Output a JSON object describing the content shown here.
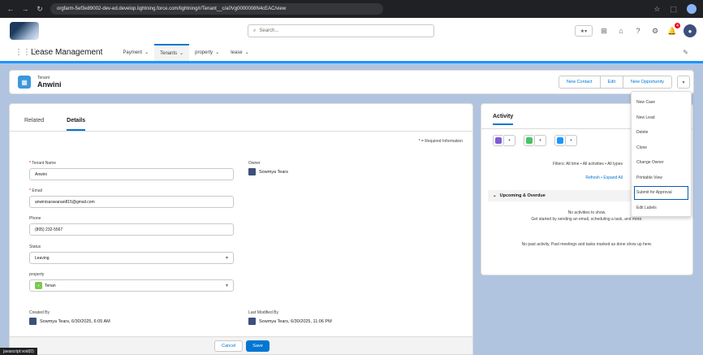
{
  "browser": {
    "url": "orgfarm-5ef3e89002-dev-ed.develop.lightning.force.com/lightning/r/Tenant__c/a0Vg0000008N4cEAC/view"
  },
  "search": {
    "placeholder": "Search..."
  },
  "nav": {
    "app_name": "Lease Management",
    "tabs": [
      {
        "label": "Payment"
      },
      {
        "label": "Tenants"
      },
      {
        "label": "property"
      },
      {
        "label": "lease"
      }
    ]
  },
  "record": {
    "type_label": "Tenant",
    "name": "Anwini",
    "actions": [
      "New Contact",
      "Edit",
      "New Opportunity"
    ]
  },
  "dropdown": {
    "items": [
      "New Case",
      "New Lead",
      "Delete",
      "Clone",
      "Change Owner",
      "Printable View",
      "Submit for Approval",
      "Edit Labels"
    ],
    "focused_index": 6
  },
  "tabs": {
    "related": "Related",
    "details": "Details"
  },
  "required_note": "= Required Information",
  "form": {
    "tenant_name": {
      "label": "Tenant Name",
      "value": "Anwini"
    },
    "owner": {
      "label": "Owner",
      "value": "Sowmya Tears"
    },
    "email": {
      "label": "Email",
      "value": "anwinisaravanan815@gmail.com"
    },
    "phone": {
      "label": "Phone",
      "value": "(805) 232-5567"
    },
    "status": {
      "label": "Status",
      "value": "Leaving"
    },
    "property": {
      "label": "property",
      "value": "Tenan"
    },
    "created_by": {
      "label": "Created By",
      "value": "Sowmya Tears, 6/30/2025, 6:05 AM"
    },
    "modified_by": {
      "label": "Last Modified By",
      "value": "Sowmya Tears, 6/30/2025, 11:06 PM"
    }
  },
  "buttons": {
    "cancel": "Cancel",
    "save": "Save"
  },
  "activity": {
    "title": "Activity",
    "filters": "Filters: All time • All activities • All types",
    "refresh": "Refresh • Expand All",
    "upcoming": "Upcoming & Overdue",
    "no_activity_1": "No activities to show.",
    "no_activity_2": "Get started by sending an email, scheduling a task, and more.",
    "past_activity": "No past activity. Past meetings and tasks marked as done show up here."
  },
  "status_tip": "javascript:void(0)",
  "colors": {
    "brand": "#0176d3",
    "nav_accent": "#1b96ff",
    "background": "#b0c4df",
    "email_action": "#7f5ad6",
    "call_action": "#48c263",
    "task_action": "#1b96ff"
  },
  "icons": {
    "search": "search-icon",
    "favorites": "star-icon",
    "add": "plus-icon",
    "help": "question-icon",
    "setup": "gear-icon",
    "notifications": "bell-icon",
    "notification_count": "4"
  }
}
